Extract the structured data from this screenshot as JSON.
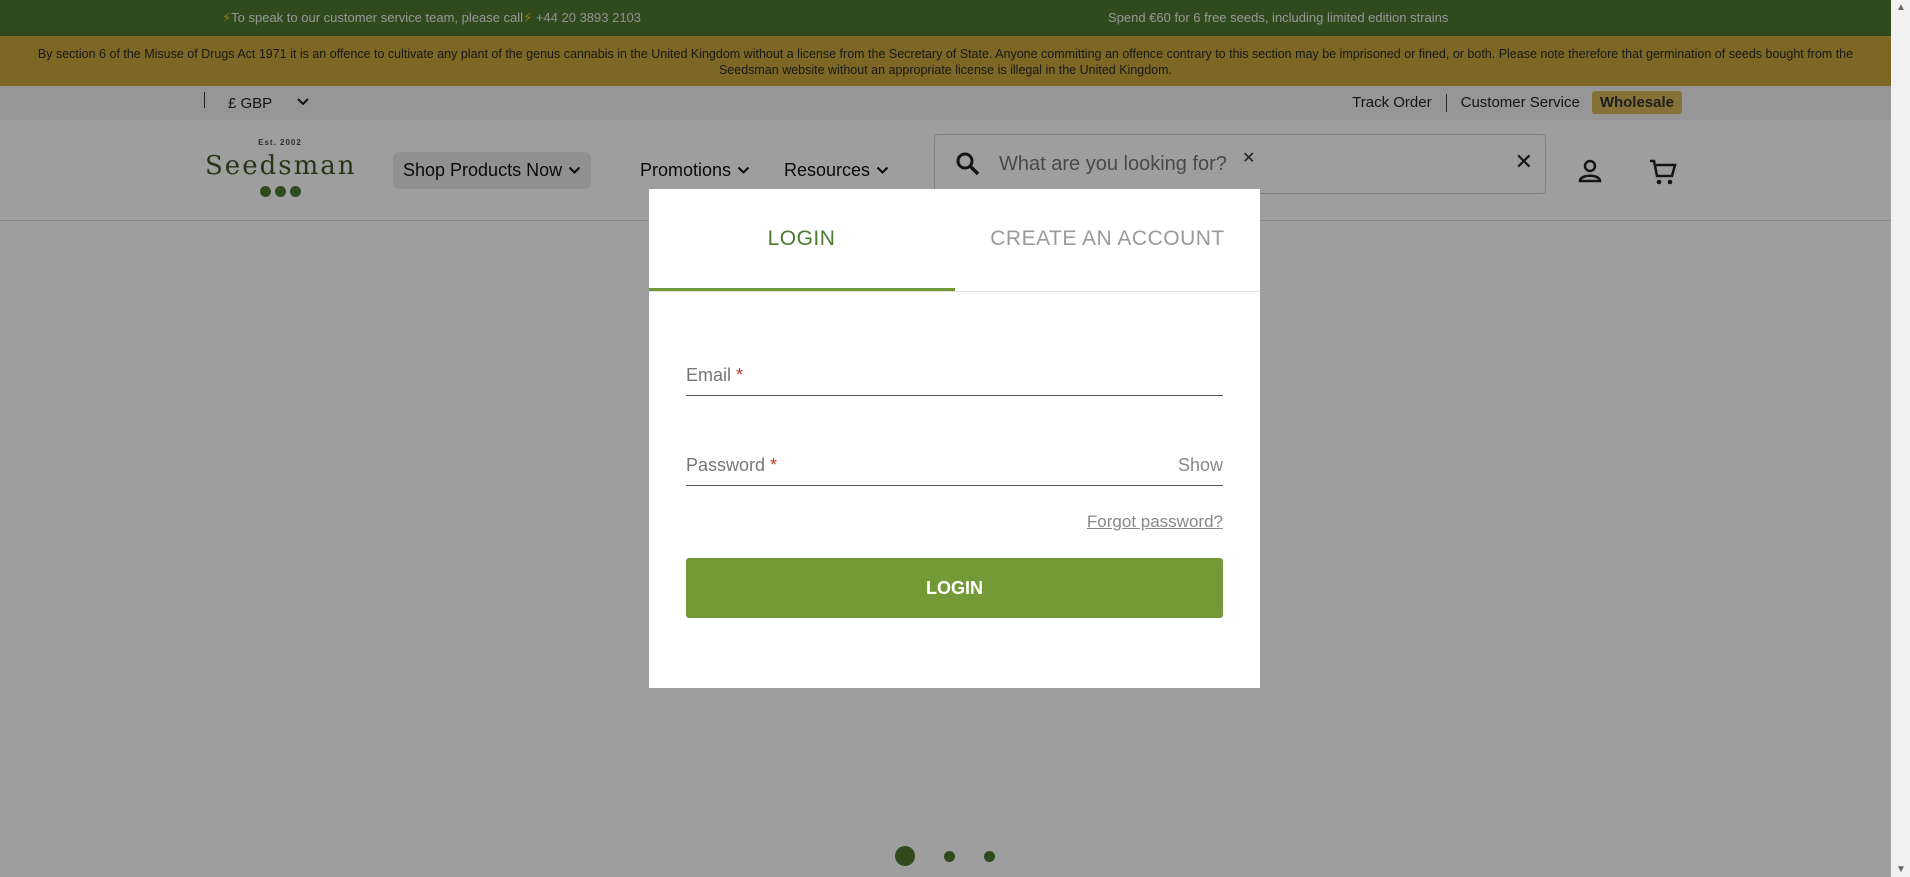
{
  "topbar": {
    "service_text": "To speak to our customer service team, please call",
    "phone": "+44 20 3893 2103",
    "promo": "Spend €60 for 6 free seeds, including limited edition strains"
  },
  "legal": {
    "text": "By section 6 of the Misuse of Drugs Act 1971 it is an offence to cultivate any plant of the genus cannabis in the United Kingdom without a license from the Secretary of State. Anyone committing an offence contrary to this section may be imprisoned or fined, or both. Please note therefore that germination of seeds bought from the Seedsman website without an appropriate license is illegal in the United Kingdom."
  },
  "utility": {
    "currency": "£ GBP",
    "links": [
      "Track Order",
      "Customer Service"
    ],
    "wholesale": "Wholesale"
  },
  "header": {
    "logo_est": "Est. 2002",
    "logo_name": "Seedsman",
    "nav": [
      "Shop Products Now",
      "Promotions",
      "Resources"
    ],
    "search_placeholder": "What are you looking for?"
  },
  "modal": {
    "tab_login": "LOGIN",
    "tab_create": "CREATE AN ACCOUNT",
    "email_label": "Email",
    "password_label": "Password",
    "required_mark": "*",
    "show_label": "Show",
    "forgot": "Forgot password?",
    "login_button": "LOGIN"
  },
  "carousel": {
    "active_index": 0,
    "count": 3
  },
  "colors": {
    "brand_green": "#4c7a2f",
    "button_green": "#739a37",
    "legal_yellow": "#c9a63a"
  }
}
